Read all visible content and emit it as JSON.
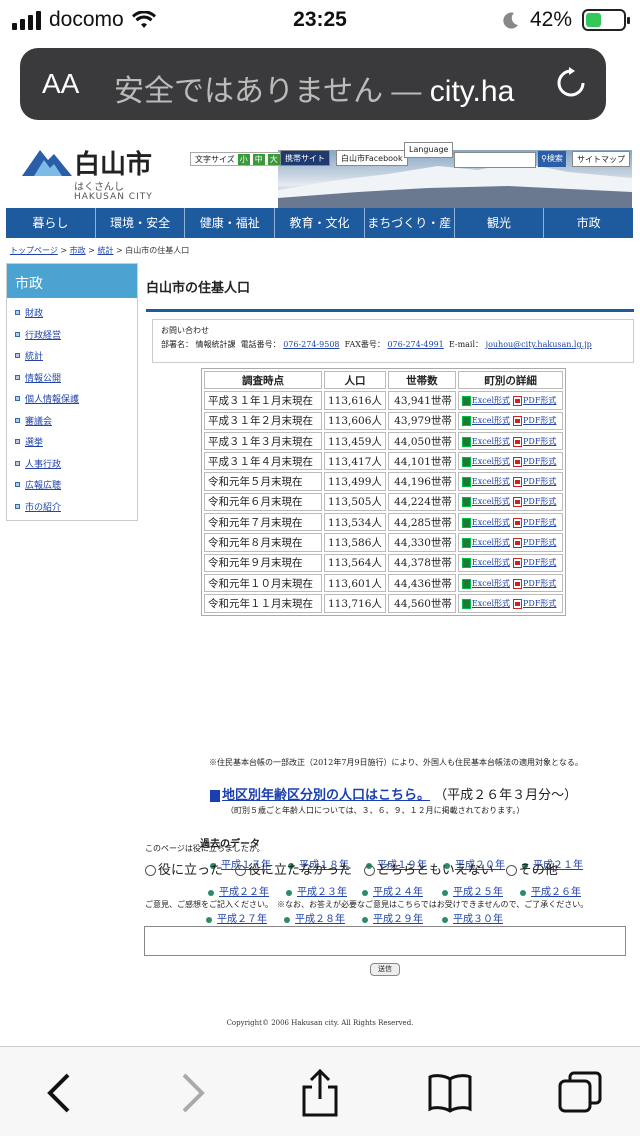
{
  "status": {
    "carrier": "docomo",
    "time": "23:25",
    "battery": "42%",
    "battery_level": 0.42
  },
  "browser": {
    "aa": "AA",
    "url_prefix": "安全ではありません — ",
    "url_host": "city.ha"
  },
  "header": {
    "logo_name": "白山市",
    "logo_kana": "はくさんし",
    "logo_en": "HAKUSAN CITY",
    "font_size_label": "文字サイズ",
    "font_sizes": [
      "小",
      "中",
      "大"
    ],
    "mobile_site": "携帯サイト",
    "facebook": "白山市Facebook",
    "language": "Language",
    "search": "検索",
    "sitemap": "サイトマップ"
  },
  "gnav": [
    "暮らし",
    "環境・安全",
    "健康・福祉",
    "教育・文化",
    "まちづくり・産業",
    "観光",
    "市政"
  ],
  "breadcrumb": [
    "トップページ",
    "市政",
    "統計",
    "白山市の住基人口"
  ],
  "side": {
    "title": "市政",
    "items": [
      "財政",
      "行政経営",
      "統計",
      "情報公開",
      "個人情報保護",
      "審議会",
      "選挙",
      "人事行政",
      "広報広聴",
      "市の紹介"
    ]
  },
  "page": {
    "title": "白山市の住基人口",
    "inquiry": {
      "label": "お問い合わせ",
      "dept_label": "部署名：",
      "dept": "情報統計課",
      "tel_label": "電話番号：",
      "tel": "076-274-9508",
      "fax_label": "FAX番号：",
      "fax": "076-274-4991",
      "email_label": "E-mail：",
      "email": "jouhou@city.hakusan.lg.jp"
    },
    "table": {
      "headers": [
        "調査時点",
        "人口",
        "世帯数",
        "町別の詳細"
      ],
      "excel": "Excel形式",
      "pdf": "PDF形式",
      "rows": [
        [
          "平成３１年１月末現在",
          "113,616人",
          "43,941世帯"
        ],
        [
          "平成３１年２月末現在",
          "113,606人",
          "43,979世帯"
        ],
        [
          "平成３１年３月末現在",
          "113,459人",
          "44,050世帯"
        ],
        [
          "平成３１年４月末現在",
          "113,417人",
          "44,101世帯"
        ],
        [
          "令和元年５月末現在",
          "113,499人",
          "44,196世帯"
        ],
        [
          "令和元年６月末現在",
          "113,505人",
          "44,224世帯"
        ],
        [
          "令和元年７月末現在",
          "113,534人",
          "44,285世帯"
        ],
        [
          "令和元年８月末現在",
          "113,586人",
          "44,330世帯"
        ],
        [
          "令和元年９月末現在",
          "113,564人",
          "44,378世帯"
        ],
        [
          "令和元年１０月末現在",
          "113,601人",
          "44,436世帯"
        ],
        [
          "令和元年１１月末現在",
          "113,716人",
          "44,560世帯"
        ]
      ]
    },
    "note": "※住民基本台帳の一部改正（2012年7月9日施行）により、外国人も住民基本台帳法の適用対象となる。",
    "district_link": "地区別年齢区分別の人口はこちら。",
    "district_suffix": "（平成２６年３月分〜）",
    "district_sub": "（町別５歳ごと年齢人口については、３、６、９、１２月に掲載されております。）",
    "past_title": "過去のデータ",
    "past_years": [
      "平成１７年",
      "平成１８年",
      "平成１９年",
      "平成２０年",
      "平成２１年",
      "平成２２年",
      "平成２３年",
      "平成２４年",
      "平成２５年",
      "平成２６年",
      "平成２７年",
      "平成２８年",
      "平成２９年",
      "平成３０年"
    ]
  },
  "feedback": {
    "question": "このページは役に立ちましたか。",
    "options": [
      "役に立った",
      "役に立たなかった",
      "どちらともいえない",
      "その他"
    ],
    "comment": "ご意見、ご感想をご記入ください。　※なお、お答えが必要なご意見はこちらではお受けできませんので、ご了承ください。",
    "submit": "送信"
  },
  "copyright": "Copyright© 2006 Hakusan city. All Rights Reserved."
}
